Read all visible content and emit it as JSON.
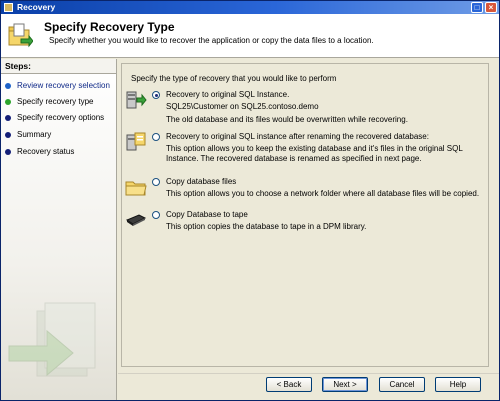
{
  "window": {
    "title": "Recovery"
  },
  "header": {
    "title": "Specify Recovery Type",
    "subtitle": "Specify whether you would like to recover the application or copy the data files to a location."
  },
  "sidebar": {
    "heading": "Steps:",
    "items": [
      {
        "label": "Review recovery selection",
        "state": "done"
      },
      {
        "label": "Specify recovery type",
        "state": "current"
      },
      {
        "label": "Specify recovery options",
        "state": "pending"
      },
      {
        "label": "Summary",
        "state": "pending"
      },
      {
        "label": "Recovery status",
        "state": "pending"
      }
    ]
  },
  "main": {
    "intro": "Specify the type of recovery that you would like to perform",
    "options": [
      {
        "label": "Recovery to original SQL Instance.",
        "detail": "SQL25\\Customer on SQL25.contoso.demo",
        "description": "The old database and its files would be overwritten while recovering.",
        "selected": true,
        "icon": "server-restore-icon"
      },
      {
        "label": "Recovery to original SQL instance after renaming the recovered database:",
        "description": "This option allows you to keep the existing database and it's files in the original SQL Instance. The recovered database is renamed as specified in next page.",
        "selected": false,
        "icon": "rename-database-icon"
      },
      {
        "label": "Copy database files",
        "description": "This option allows you to choose a network folder where all database files will be copied.",
        "selected": false,
        "icon": "folder-icon"
      },
      {
        "label": "Copy Database to tape",
        "description": "This option copies the database to tape in a DPM library.",
        "selected": false,
        "icon": "tape-icon"
      }
    ]
  },
  "buttons": {
    "back": "Back",
    "next": "Next",
    "cancel": "Cancel",
    "help": "Help"
  },
  "colors": {
    "titlebar": "#0a3fa8",
    "step_done": "#102a88",
    "step_current_dot": "#2ca42c"
  }
}
